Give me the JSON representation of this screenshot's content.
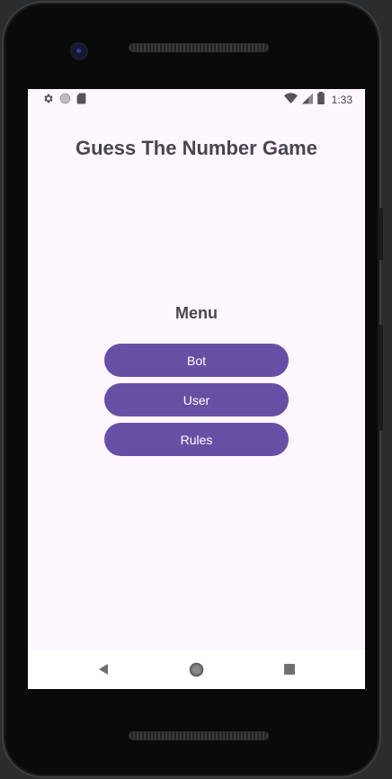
{
  "device": {
    "frame_color": "#0a0a0a"
  },
  "status_bar": {
    "time": "1:33",
    "left_icons": [
      "gear-icon",
      "circle-icon",
      "sd-card-icon"
    ],
    "right_icons": [
      "wifi-icon",
      "signal-icon",
      "battery-icon"
    ]
  },
  "app": {
    "title": "Guess The Number Game",
    "background": "#fef7ff",
    "accent": "#6750a4",
    "text_color": "#49454f"
  },
  "menu": {
    "heading": "Menu",
    "buttons": [
      {
        "label": "Bot"
      },
      {
        "label": "User"
      },
      {
        "label": "Rules"
      }
    ]
  },
  "nav_bar": {
    "items": [
      "back-icon",
      "home-icon",
      "recents-icon"
    ]
  }
}
